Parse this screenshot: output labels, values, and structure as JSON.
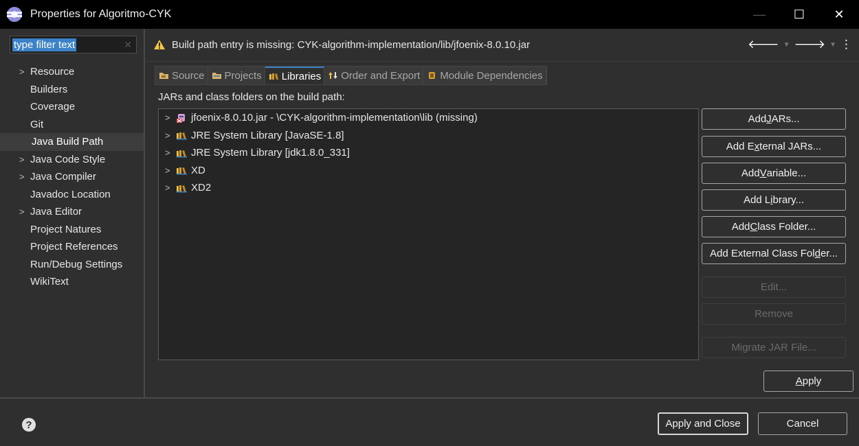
{
  "window": {
    "title": "Properties for Algoritmo-CYK",
    "controls": {
      "minimize": "—",
      "maximize": "☐",
      "close": "✕"
    }
  },
  "sidebar": {
    "filter_value": "type filter text",
    "items": [
      {
        "label": "Resource",
        "expandable": true
      },
      {
        "label": "Builders",
        "expandable": false
      },
      {
        "label": "Coverage",
        "expandable": false
      },
      {
        "label": "Git",
        "expandable": false
      },
      {
        "label": "Java Build Path",
        "expandable": false,
        "selected": true
      },
      {
        "label": "Java Code Style",
        "expandable": true
      },
      {
        "label": "Java Compiler",
        "expandable": true
      },
      {
        "label": "Javadoc Location",
        "expandable": false
      },
      {
        "label": "Java Editor",
        "expandable": true
      },
      {
        "label": "Project Natures",
        "expandable": false
      },
      {
        "label": "Project References",
        "expandable": false
      },
      {
        "label": "Run/Debug Settings",
        "expandable": false
      },
      {
        "label": "WikiText",
        "expandable": false
      }
    ]
  },
  "message": {
    "text": "Build path entry is missing: CYK-algorithm-implementation/lib/jfoenix-8.0.10.jar"
  },
  "tabs": [
    {
      "label": "Source",
      "icon": "source-folder-icon"
    },
    {
      "label": "Projects",
      "icon": "projects-icon"
    },
    {
      "label": "Libraries",
      "icon": "libraries-icon",
      "active": true
    },
    {
      "label": "Order and Export",
      "icon": "order-export-icon"
    },
    {
      "label": "Module Dependencies",
      "icon": "module-icon"
    }
  ],
  "libraries": {
    "heading": "JARs and class folders on the build path:",
    "entries": [
      {
        "label": "jfoenix-8.0.10.jar - \\CYK-algorithm-implementation\\lib (missing)",
        "icon": "missing-jar-icon"
      },
      {
        "label": "JRE System Library [JavaSE-1.8]",
        "icon": "library-icon"
      },
      {
        "label": "JRE System Library [jdk1.8.0_331]",
        "icon": "library-icon"
      },
      {
        "label": "XD",
        "icon": "library-icon"
      },
      {
        "label": "XD2",
        "icon": "library-icon"
      }
    ]
  },
  "buttons": {
    "add_jars": {
      "pre": "Add ",
      "u": "J",
      "post": "ARs..."
    },
    "add_external_jars": {
      "pre": "Add E",
      "u": "x",
      "post": "ternal JARs..."
    },
    "add_variable": {
      "pre": "Add ",
      "u": "V",
      "post": "ariable..."
    },
    "add_library": {
      "pre": "Add L",
      "u": "i",
      "post": "brary..."
    },
    "add_class_folder": {
      "pre": "Add ",
      "u": "C",
      "post": "lass Folder..."
    },
    "add_external_class_folder": {
      "pre": "Add External Class Fol",
      "u": "d",
      "post": "er..."
    },
    "edit": "Edit...",
    "remove": "Remove",
    "migrate": "Migrate JAR File...",
    "apply": {
      "pre": "",
      "u": "A",
      "post": "pply"
    }
  },
  "footer": {
    "apply_and_close": "Apply and Close",
    "cancel": "Cancel"
  },
  "colors": {
    "accent": "#3c82c8",
    "background": "#2f2f2f",
    "warning": "#f2c744"
  }
}
